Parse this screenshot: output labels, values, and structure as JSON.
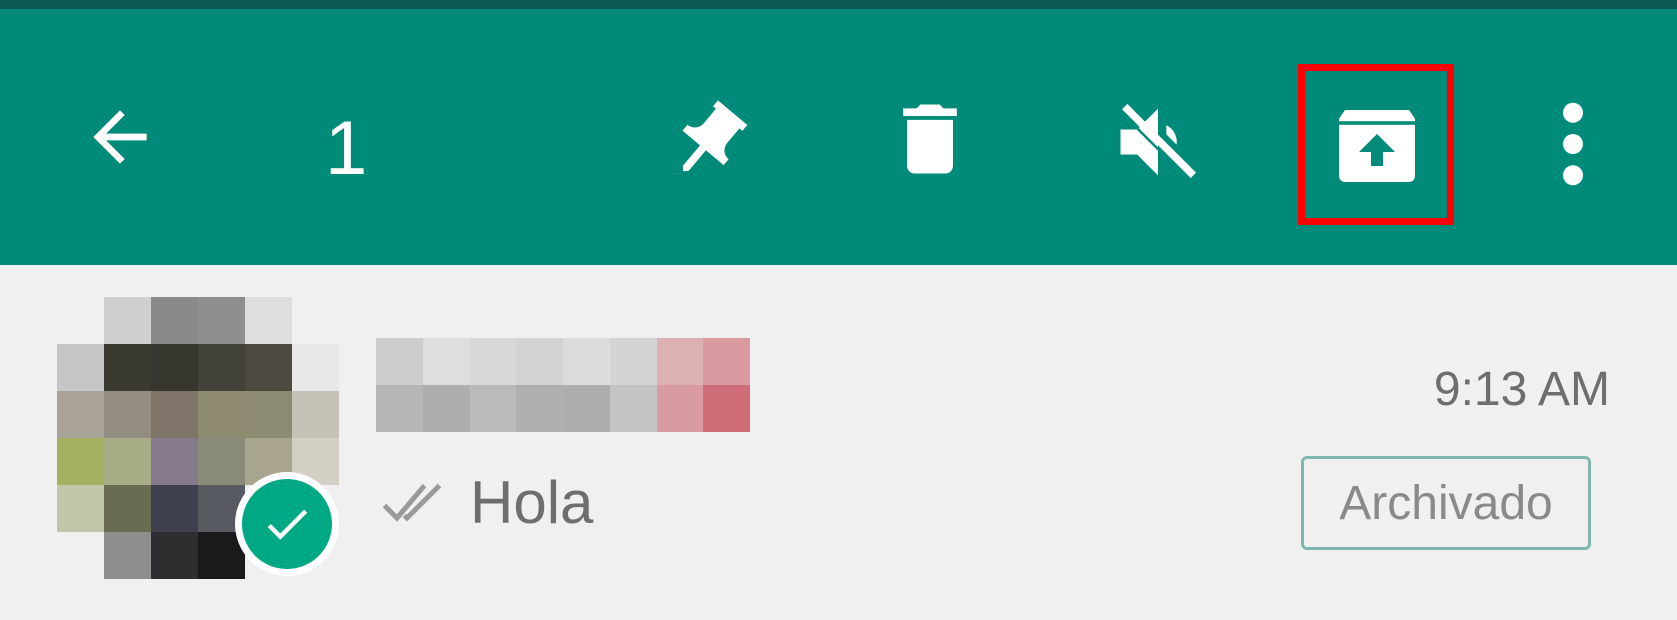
{
  "toolbar": {
    "background_color": "#008a7a",
    "selected_count": "1",
    "actions": [
      {
        "icon": "back-arrow-icon"
      },
      {
        "icon": "pin-icon"
      },
      {
        "icon": "delete-icon"
      },
      {
        "icon": "mute-icon"
      },
      {
        "icon": "unarchive-icon",
        "highlighted": true
      },
      {
        "icon": "more-vertical-icon"
      }
    ],
    "highlight_color": "#ff0000"
  },
  "chat": {
    "time": "9:13 AM",
    "preview_text": "Hola",
    "status_icon": "double-check-icon",
    "badge": "Archivado",
    "selected_check_color": "#00a884",
    "avatar": "pixelated-avatar",
    "name": "pixelated-contact-name"
  }
}
